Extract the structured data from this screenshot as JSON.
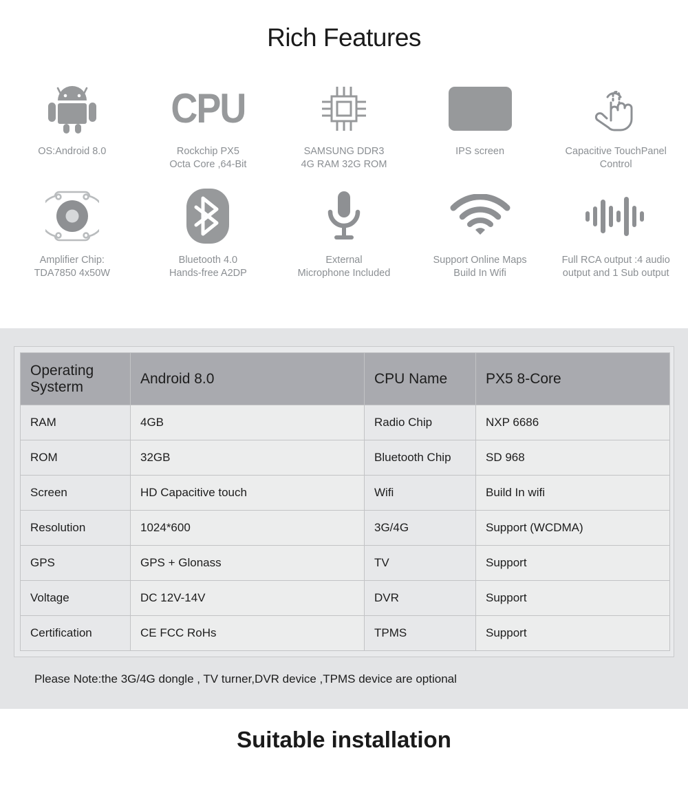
{
  "header": {
    "title": "Rich Features"
  },
  "colors": {
    "icon_gray": "#97999b",
    "label_gray": "#8b8f93",
    "panel_bg": "#e3e4e6",
    "table_header_bg": "#a9aaaf",
    "table_cell_bg": "#eceded",
    "table_border": "#c2c3c5",
    "text": "#1d1d1d"
  },
  "features": {
    "row1": [
      {
        "icon": "android-robot-icon",
        "label": "OS:Android 8.0"
      },
      {
        "icon": "cpu-text-icon",
        "icon_text": "CPU",
        "label": "Rockchip PX5\nOcta Core ,64-Bit"
      },
      {
        "icon": "memory-chip-icon",
        "label": "SAMSUNG DDR3\n4G RAM  32G ROM"
      },
      {
        "icon": "ips-screen-icon",
        "label": "IPS screen"
      },
      {
        "icon": "touch-hand-icon",
        "label": "Capacitive TouchPanel\nControl"
      }
    ],
    "row2": [
      {
        "icon": "speaker-amplifier-icon",
        "label": "Amplifier  Chip:\nTDA7850  4x50W"
      },
      {
        "icon": "bluetooth-icon",
        "label": "Bluetooth 4.0\nHands-free A2DP"
      },
      {
        "icon": "microphone-icon",
        "label": "External\nMicrophone Included"
      },
      {
        "icon": "wifi-icon",
        "label": "Support Online Maps\nBuild In Wifi"
      },
      {
        "icon": "audio-waveform-icon",
        "label": "Full RCA output :4 audio\noutput and 1 Sub output"
      }
    ]
  },
  "spec_table": {
    "rows": [
      {
        "header": true,
        "c1": "Operating\nSysterm",
        "c2": "Android 8.0",
        "c3": "CPU Name",
        "c4": "PX5 8-Core"
      },
      {
        "header": false,
        "c1": "RAM",
        "c2": "4GB",
        "c3": "Radio Chip",
        "c4": "NXP 6686"
      },
      {
        "header": false,
        "c1": "ROM",
        "c2": "32GB",
        "c3": "Bluetooth Chip",
        "c4": "SD 968"
      },
      {
        "header": false,
        "c1": "Screen",
        "c2": "HD Capacitive touch",
        "c3": "Wifi",
        "c4": "Build In wifi"
      },
      {
        "header": false,
        "c1": "Resolution",
        "c2": "1024*600",
        "c3": "3G/4G",
        "c4": "Support (WCDMA)"
      },
      {
        "header": false,
        "c1": "GPS",
        "c2": "GPS + Glonass",
        "c3": "TV",
        "c4": "Support"
      },
      {
        "header": false,
        "c1": "Voltage",
        "c2": "DC 12V-14V",
        "c3": "DVR",
        "c4": "Support"
      },
      {
        "header": false,
        "c1": "Certification",
        "c2": "CE FCC RoHs",
        "c3": "TPMS",
        "c4": "Support"
      }
    ],
    "note": "Please Note:the 3G/4G dongle , TV turner,DVR device ,TPMS device are optional"
  },
  "footer": {
    "title": "Suitable installation"
  }
}
